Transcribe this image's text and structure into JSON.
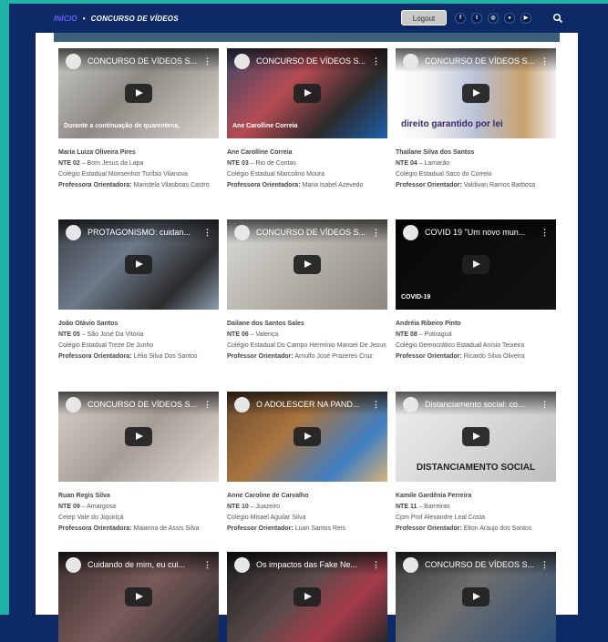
{
  "nav": {
    "home": "INÍCIO",
    "separator": "•",
    "current": "CONCURSO DE VÍDEOS",
    "logout": "Logout",
    "social_icons": [
      "facebook-icon",
      "twitter-icon",
      "instagram-icon",
      "flickr-icon",
      "youtube-icon"
    ]
  },
  "colors": {
    "navy": "#0d2a66",
    "teal": "#1fb3a8",
    "link_purple": "#6a5cff"
  },
  "labels": {
    "nte_prefix": "NTE",
    "orient_fem": "Professora Orientadora:",
    "orient_masc": "Professor Orientador:"
  },
  "videos": [
    {
      "title": "CONCURSO DE VÍDEOS S...",
      "overlay": "Durante a continuação de quarentena,",
      "name": "Maria Luiza Oliveira Pires",
      "nte": "NTE 02",
      "city": "– Bom Jesus da Lapa",
      "school": "Colégio Estadual Monsenhor Turíbio Vilanova",
      "orient_label": "Professora Orientadora:",
      "orient": "Maristela Vilasboas Castro"
    },
    {
      "title": "CONCURSO DE VÍDEOS S...",
      "overlay": "Ane Carolline Correia",
      "name": "Ane Carolline Correia",
      "nte": "NTE 03",
      "city": "– Rio de Contas",
      "school": "Colégio Estadual Marcolino Moura",
      "orient_label": "Professora Orientadora:",
      "orient": "Maria Isabel Azevedo"
    },
    {
      "title": "CONCURSO DE VÍDEOS S...",
      "overlay": "direito garantido por lei",
      "name": "Thailane Silva dos Santos",
      "nte": "NTE 04",
      "city": "– Lamarão",
      "school": "Colégio Estadual Saco do Correio",
      "orient_label": "Professor Orientador:",
      "orient": "Valdivan Ramos Barbosa"
    },
    {
      "title": "PROTAGONISMO: cuidan...",
      "overlay": "",
      "name": "João Otávio Santos",
      "nte": "NTE 05",
      "city": "– São José Da Vitória",
      "school": "Colégio Estadual Treze De Junho",
      "orient_label": "Professora Orientadora:",
      "orient": "Lélia Silva Dos Santos"
    },
    {
      "title": "CONCURSO DE VÍDEOS S...",
      "overlay": "",
      "name": "Dailane dos Santos Sales",
      "nte": "NTE 06",
      "city": "– Valença",
      "school": "Colégio Estadual Do Campo Hermínio Manoel De Jesus",
      "orient_label": "Professor Orientador:",
      "orient": "Arnulfo José Prazeres Cruz"
    },
    {
      "title": "COVID 19 \"Um novo mun...",
      "overlay": "COVID-19",
      "name": "Andréia Ribeiro Pinto",
      "nte": "NTE 08",
      "city": "– Potiraguá",
      "school": "Colégio Democrático Estadual Anísio Teixeira",
      "orient_label": "Professor Orientador:",
      "orient": "Ricardo Silva Oliveira"
    },
    {
      "title": "CONCURSO DE VÍDEOS S...",
      "overlay": "",
      "name": "Ruan Regis Silva",
      "nte": "NTE 09",
      "city": "– Amargosa",
      "school": "Cetep Vale do Jiquiriçá",
      "orient_label": "Professora Orientadora:",
      "orient": "Maianna de Assis Silva"
    },
    {
      "title": "O ADOLESCER NA PAND...",
      "overlay": "",
      "name": "Anne Caroline de Carvalho",
      "nte": "NTE 10",
      "city": "– Juazeiro",
      "school": "Colegio Misael Aguilar Silva",
      "orient_label": "Professor Orientador:",
      "orient": "Luan Santos Reis"
    },
    {
      "title": "Distanciamento social: co...",
      "overlay": "DISTANCIAMENTO SOCIAL",
      "name": "Kamile Gardênia Ferreira",
      "nte": "NTE 11",
      "city": "– Barreiras",
      "school": "Cpm Prof Alexandre Leal Costa",
      "orient_label": "Professor Orientador:",
      "orient": "Elton Araujo dos Santos"
    },
    {
      "title": "Cuidando de mim, eu cui...",
      "overlay": "",
      "name": "",
      "nte": "",
      "city": "",
      "school": "",
      "orient_label": "",
      "orient": ""
    },
    {
      "title": "Os impactos das Fake Ne...",
      "overlay": "",
      "name": "",
      "nte": "",
      "city": "",
      "school": "",
      "orient_label": "",
      "orient": ""
    },
    {
      "title": "CONCURSO DE VÍDEOS S...",
      "overlay": "",
      "name": "",
      "nte": "",
      "city": "",
      "school": "",
      "orient_label": "",
      "orient": ""
    }
  ]
}
